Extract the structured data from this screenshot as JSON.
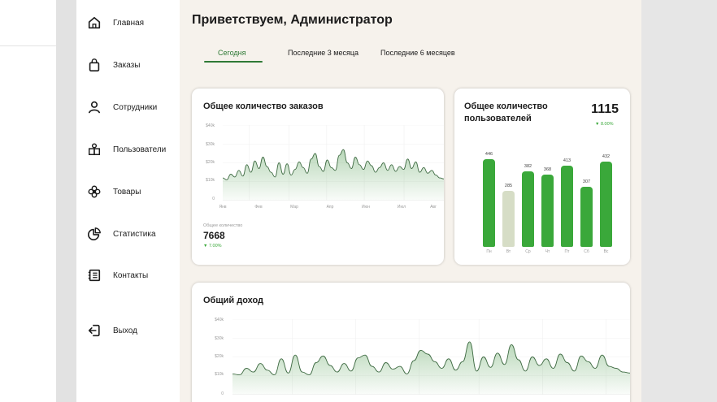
{
  "sidebar": {
    "items": [
      {
        "label": "Главная",
        "icon": "home-icon"
      },
      {
        "label": "Заказы",
        "icon": "shopping-bag-icon"
      },
      {
        "label": "Сотрудники",
        "icon": "user-icon"
      },
      {
        "label": "Пользователи",
        "icon": "users-icon"
      },
      {
        "label": "Товары",
        "icon": "flower-icon"
      },
      {
        "label": "Статистика",
        "icon": "pie-chart-icon"
      },
      {
        "label": "Контакты",
        "icon": "address-book-icon"
      },
      {
        "label": "Выход",
        "icon": "logout-icon"
      }
    ]
  },
  "header": {
    "greeting": "Приветствуем, Администратор"
  },
  "tabs": [
    {
      "label": "Сегодня",
      "active": true
    },
    {
      "label": "Последние 3 месяца",
      "active": false
    },
    {
      "label": "Последние 6 месяцев",
      "active": false
    }
  ],
  "colors": {
    "accent": "#2f7a36",
    "bar_green": "#3aa83a",
    "bar_muted": "#d6ddc6",
    "positive": "#3aa83a",
    "main_bg": "#f6f2ec"
  },
  "orders_card": {
    "title": "Общее количество заказов",
    "summary_label": "Общее количество",
    "summary_value": "7668",
    "summary_change": "▼ 7.00%"
  },
  "users_card": {
    "title": "Общее количество пользователей",
    "total": "1115",
    "change": "▼ 8.00%"
  },
  "revenue_card": {
    "title": "Общий доход"
  },
  "chart_data": [
    {
      "type": "area",
      "yticks": [
        "$40k",
        "$30k",
        "$20k",
        "$10k",
        "0"
      ],
      "ylim": [
        0,
        40000
      ],
      "categories": [
        "Янв",
        "Фев",
        "Мар",
        "Апр",
        "Июн",
        "Июл",
        "Авг"
      ],
      "values": [
        12000,
        11000,
        14000,
        12500,
        16000,
        13000,
        19000,
        15000,
        21000,
        17000,
        23000,
        18000,
        15000,
        12500,
        20000,
        14000,
        19500,
        13500,
        16500,
        20500,
        17500,
        14500,
        22000,
        25000,
        18000,
        15500,
        21500,
        17500,
        16000,
        24000,
        27000,
        20000,
        17000,
        23000,
        19000,
        16500,
        21000,
        18500,
        15000,
        17500,
        20000,
        16000,
        19000,
        15500,
        18000,
        16500,
        22000,
        17000,
        20500,
        15000,
        17500,
        14500,
        16000,
        13500,
        12000,
        11500
      ]
    },
    {
      "type": "bar",
      "categories": [
        "Пн",
        "Вт",
        "Ср",
        "Чт",
        "Пт",
        "Сб",
        "Вс"
      ],
      "values": [
        446,
        285,
        382,
        368,
        413,
        307,
        432
      ],
      "highlight": [
        true,
        false,
        true,
        true,
        true,
        true,
        true
      ]
    },
    {
      "type": "area",
      "yticks": [
        "$40k",
        "$30k",
        "$20k",
        "$10k",
        "0"
      ],
      "ylim": [
        0,
        40000
      ],
      "values": [
        11000,
        10500,
        14000,
        12000,
        16500,
        13000,
        10500,
        19000,
        11500,
        21000,
        12000,
        10500,
        17000,
        20500,
        15500,
        12000,
        16500,
        12500,
        19500,
        21000,
        15000,
        12000,
        17000,
        13500,
        15000,
        11000,
        18000,
        23500,
        21500,
        17500,
        14000,
        19000,
        13000,
        17500,
        28000,
        12500,
        20000,
        14500,
        22000,
        16000,
        26500,
        18500,
        12500,
        20000,
        15500,
        19000,
        14000,
        21500,
        17000,
        12500,
        20500,
        17500,
        14000,
        21000,
        15000,
        14000,
        12000,
        11500
      ]
    }
  ]
}
